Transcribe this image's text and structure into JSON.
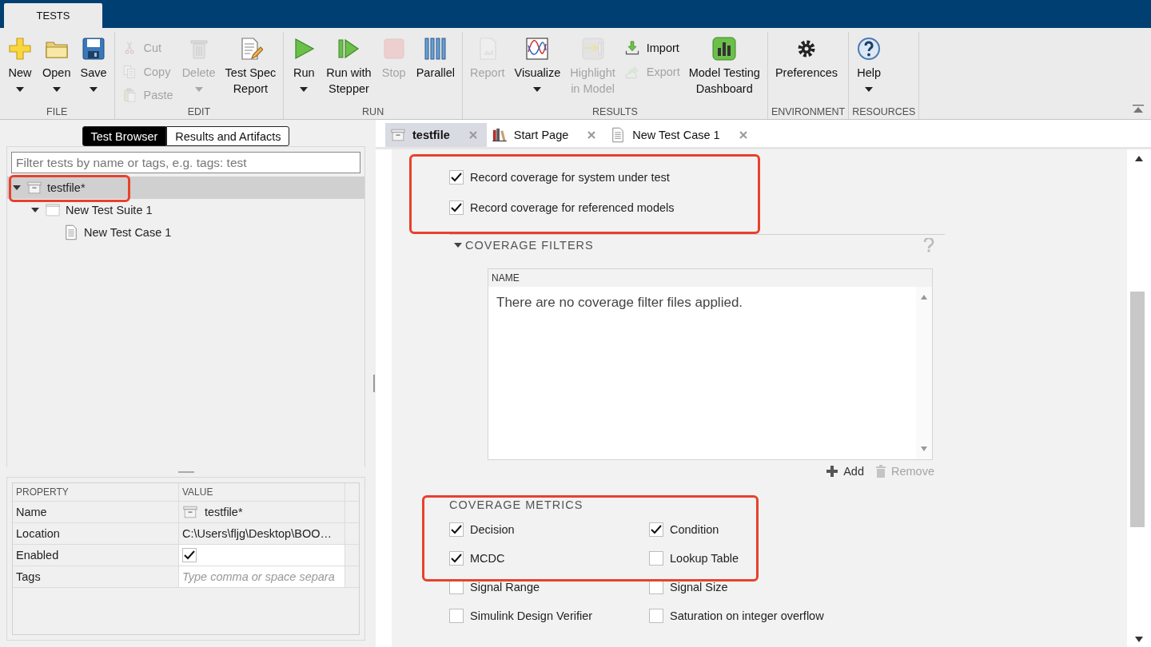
{
  "app_tabs": [
    {
      "label": "TESTS",
      "selected": true
    }
  ],
  "ribbon": [
    {
      "label": "FILE",
      "items": [
        {
          "kind": "large",
          "label": "New",
          "dropdown": true,
          "disabled": false
        },
        {
          "kind": "large",
          "label": "Open",
          "dropdown": true,
          "disabled": false
        },
        {
          "kind": "large",
          "label": "Save",
          "dropdown": true,
          "disabled": false
        }
      ]
    },
    {
      "label": "EDIT",
      "items": [
        {
          "kind": "stack",
          "items": [
            {
              "label": "Cut",
              "disabled": true
            },
            {
              "label": "Copy",
              "disabled": true
            },
            {
              "label": "Paste",
              "disabled": true
            }
          ]
        },
        {
          "kind": "large",
          "label": "Delete",
          "dropdown": true,
          "disabled": true
        },
        {
          "kind": "large",
          "label": "Test Spec\nReport",
          "dropdown": false,
          "disabled": false
        }
      ]
    },
    {
      "label": "RUN",
      "items": [
        {
          "kind": "large",
          "label": "Run",
          "dropdown": true,
          "disabled": false
        },
        {
          "kind": "large",
          "label": "Run with\nStepper",
          "dropdown": false,
          "disabled": false
        },
        {
          "kind": "large",
          "label": "Stop",
          "dropdown": false,
          "disabled": true
        },
        {
          "kind": "large",
          "label": "Parallel",
          "dropdown": false,
          "disabled": false
        }
      ]
    },
    {
      "label": "RESULTS",
      "items": [
        {
          "kind": "large",
          "label": "Report",
          "dropdown": false,
          "disabled": true
        },
        {
          "kind": "large",
          "label": "Visualize",
          "dropdown": true,
          "disabled": false
        },
        {
          "kind": "large",
          "label": "Highlight\nin Model",
          "dropdown": false,
          "disabled": true
        },
        {
          "kind": "stack",
          "items": [
            {
              "label": "Import",
              "disabled": false
            },
            {
              "label": "Export",
              "disabled": true
            }
          ]
        },
        {
          "kind": "large",
          "label": "Model Testing\nDashboard",
          "dropdown": false,
          "disabled": false
        }
      ]
    },
    {
      "label": "ENVIRONMENT",
      "items": [
        {
          "kind": "large",
          "label": "Preferences",
          "dropdown": false,
          "disabled": false
        }
      ]
    },
    {
      "label": "RESOURCES",
      "items": [
        {
          "kind": "large",
          "label": "Help",
          "dropdown": true,
          "disabled": false
        }
      ]
    }
  ],
  "browser": {
    "tabs": [
      {
        "label": "Test Browser",
        "selected": true
      },
      {
        "label": "Results and Artifacts",
        "selected": false
      }
    ],
    "filter": {
      "placeholder": "Filter tests by name or tags, e.g. tags: test"
    },
    "tree": [
      {
        "kind": "file",
        "label": "testfile*",
        "selected": true,
        "expanded": true,
        "children": [
          {
            "kind": "suite",
            "label": "New Test Suite 1",
            "selected": false,
            "expanded": true,
            "children": [
              {
                "kind": "case",
                "label": "New Test Case 1",
                "selected": false
              }
            ]
          }
        ]
      }
    ]
  },
  "properties": {
    "columns": [
      "PROPERTY",
      "VALUE"
    ],
    "rows": [
      {
        "kind": "file",
        "name": "Name",
        "value": "testfile*"
      },
      {
        "kind": "text",
        "name": "Location",
        "value": "C:\\Users\\fljg\\Desktop\\BOO…"
      },
      {
        "kind": "checkbox",
        "name": "Enabled",
        "checked": true
      },
      {
        "kind": "tags",
        "name": "Tags",
        "placeholder": "Type comma or space separa"
      }
    ]
  },
  "editor_tabs": [
    {
      "kind": "file",
      "label": "testfile",
      "selected": true
    },
    {
      "kind": "books",
      "label": "Start Page",
      "selected": false
    },
    {
      "kind": "case",
      "label": "New Test Case 1",
      "selected": false
    }
  ],
  "coverage_collect": [
    {
      "label": "Record coverage for system under test",
      "checked": true
    },
    {
      "label": "Record coverage for referenced models",
      "checked": true
    }
  ],
  "coverage_filters": {
    "title": "COVERAGE FILTERS",
    "expanded": true,
    "column": "NAME",
    "empty_message": "There are no coverage filter files applied.",
    "actions": [
      {
        "label": "Add",
        "disabled": false
      },
      {
        "label": "Remove",
        "disabled": true
      }
    ]
  },
  "coverage_metrics": {
    "title": "COVERAGE METRICS",
    "items": [
      {
        "label": "Decision",
        "checked": true
      },
      {
        "label": "Condition",
        "checked": true
      },
      {
        "label": "MCDC",
        "checked": true
      },
      {
        "label": "Lookup Table",
        "checked": false
      },
      {
        "label": "Signal Range",
        "checked": false
      },
      {
        "label": "Signal Size",
        "checked": false
      },
      {
        "label": "Simulink Design Verifier",
        "checked": false
      },
      {
        "label": "Saturation on integer overflow",
        "checked": false
      }
    ]
  }
}
